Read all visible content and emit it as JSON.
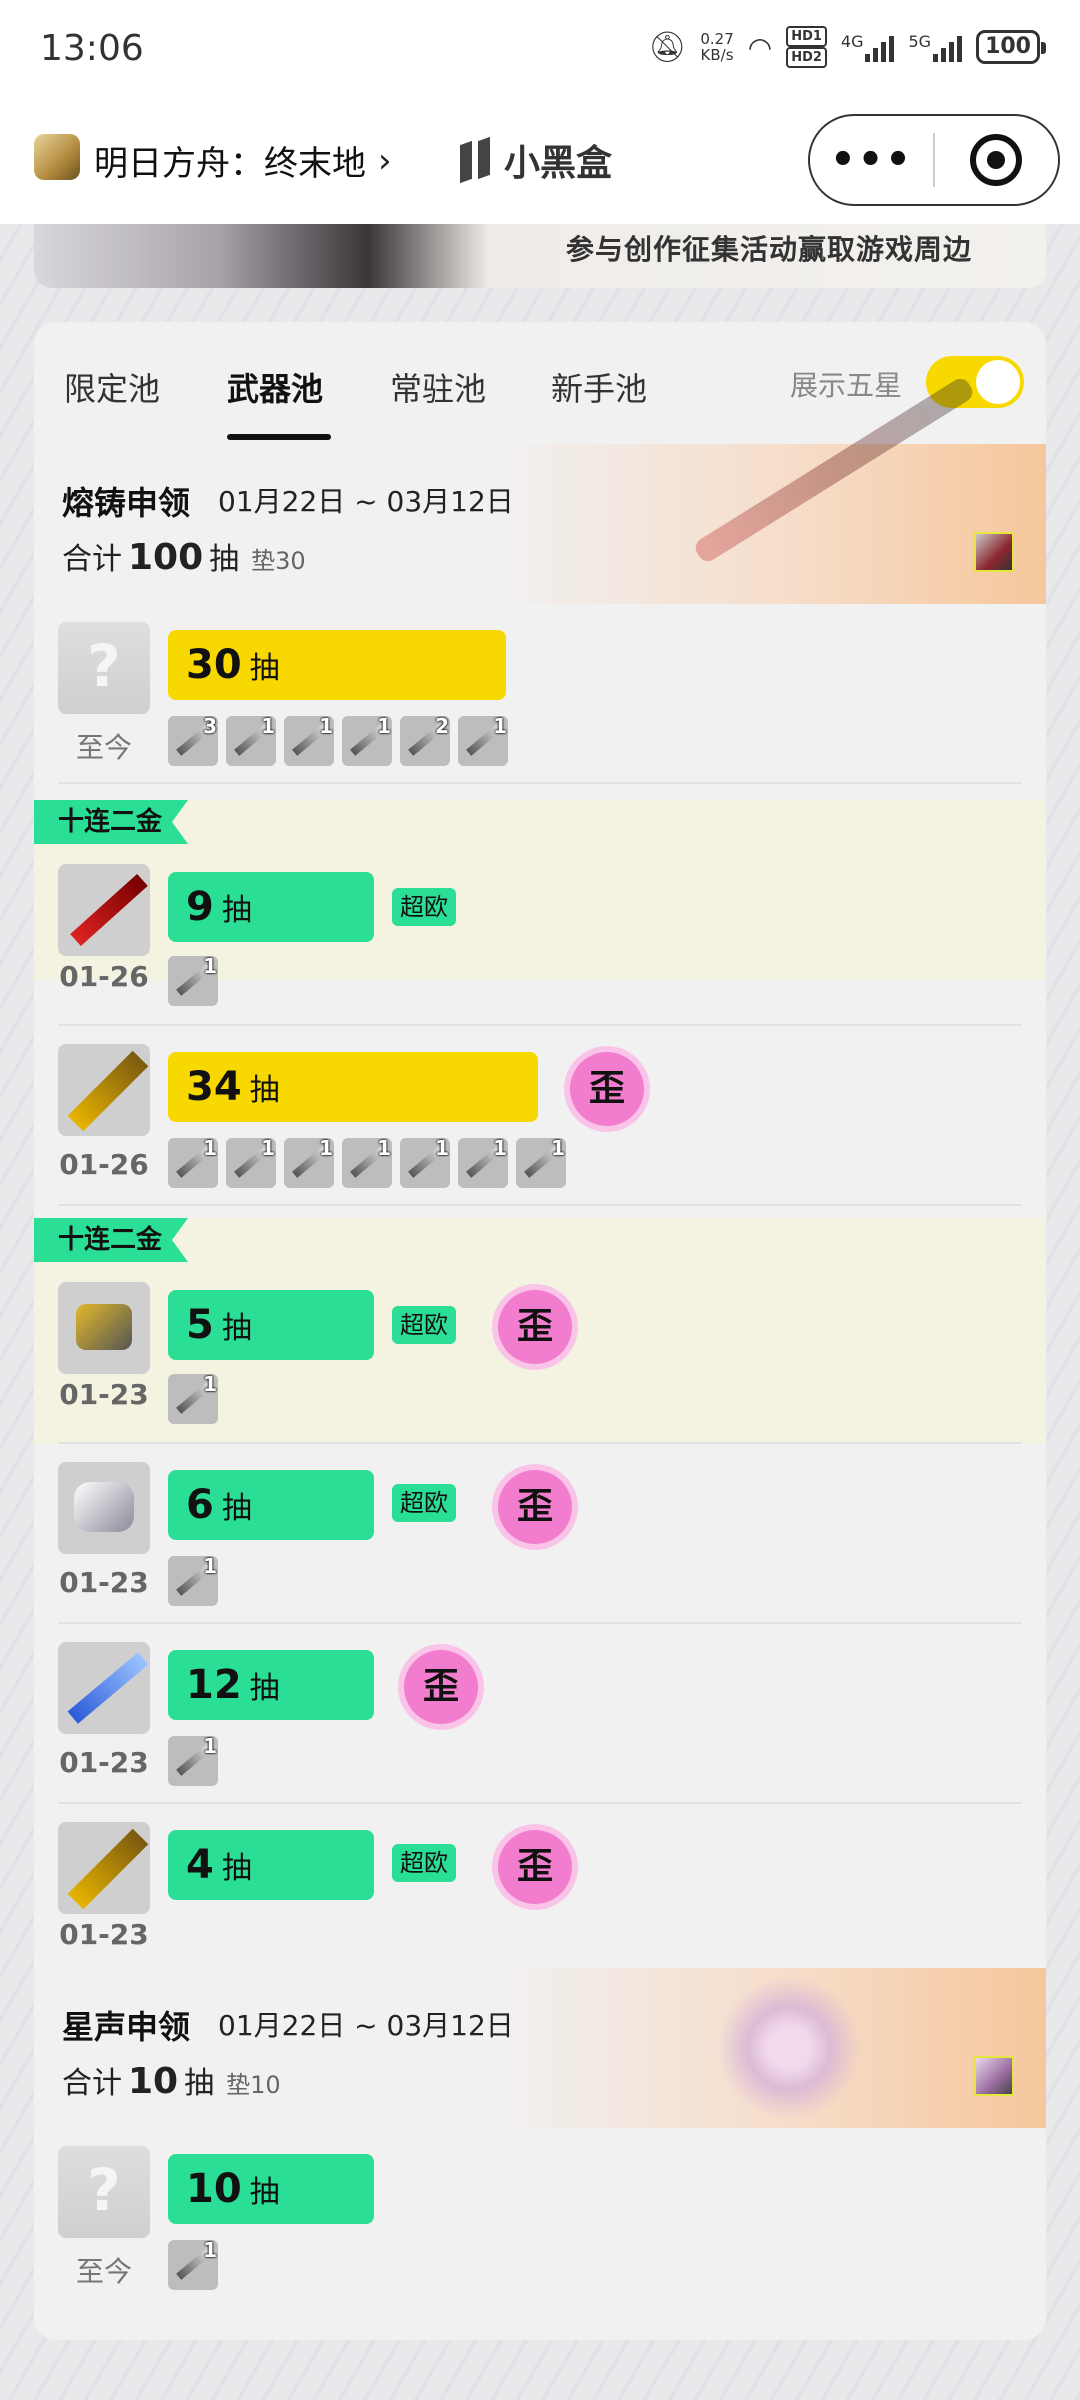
{
  "status_bar": {
    "time": "13:06",
    "net_speed": "0.27",
    "net_unit": "KB/s",
    "hd_badge": "HD1",
    "hd_badge2": "HD2",
    "net1": "4G",
    "net2": "5G",
    "battery": "100"
  },
  "nav": {
    "game_title": "明日方舟：终末地",
    "chevron": "›",
    "brand": "小黑盒",
    "more": "•••"
  },
  "banner": {
    "text": "参与创作征集活动赢取游戏周边"
  },
  "tabs": [
    {
      "label": "限定池",
      "active": false
    },
    {
      "label": "武器池",
      "active": true
    },
    {
      "label": "常驻池",
      "active": false
    },
    {
      "label": "新手池",
      "active": false
    }
  ],
  "show_five_star": {
    "label": "展示五星",
    "on": true
  },
  "pools": [
    {
      "name": "熔铸申领",
      "dates": "01月22日 ~ 03月12日",
      "total_prefix": "合计",
      "total": "100",
      "total_suffix": "抽",
      "pity": "垫30",
      "records": [
        {
          "date": "至今",
          "count": "30",
          "unit": "抽",
          "bar": "yellow",
          "items": [
            "3",
            "1",
            "1",
            "1",
            "2",
            "1"
          ]
        },
        {
          "ribbon": "十连二金",
          "date": "01-26",
          "count": "9",
          "unit": "抽",
          "bar": "green",
          "chaoou": "超欧",
          "items": [
            "1"
          ]
        },
        {
          "date": "01-26",
          "count": "34",
          "unit": "抽",
          "bar": "yellow",
          "wai": "歪",
          "items": [
            "1",
            "1",
            "1",
            "1",
            "1",
            "1",
            "1"
          ]
        },
        {
          "ribbon": "十连二金",
          "date": "01-23",
          "count": "5",
          "unit": "抽",
          "bar": "green",
          "chaoou": "超欧",
          "wai": "歪",
          "items": [
            "1"
          ]
        },
        {
          "date": "01-23",
          "count": "6",
          "unit": "抽",
          "bar": "green",
          "chaoou": "超欧",
          "wai": "歪",
          "items": [
            "1"
          ]
        },
        {
          "date": "01-23",
          "count": "12",
          "unit": "抽",
          "bar": "green",
          "wai": "歪",
          "items": [
            "1"
          ]
        },
        {
          "date": "01-23",
          "count": "4",
          "unit": "抽",
          "bar": "green",
          "chaoou": "超欧",
          "wai": "歪",
          "items": []
        }
      ]
    },
    {
      "name": "星声申领",
      "dates": "01月22日 ~ 03月12日",
      "total_prefix": "合计",
      "total": "10",
      "total_suffix": "抽",
      "pity": "垫10",
      "records": [
        {
          "date": "至今",
          "count": "10",
          "unit": "抽",
          "bar": "green",
          "items": [
            "1"
          ]
        }
      ]
    }
  ]
}
